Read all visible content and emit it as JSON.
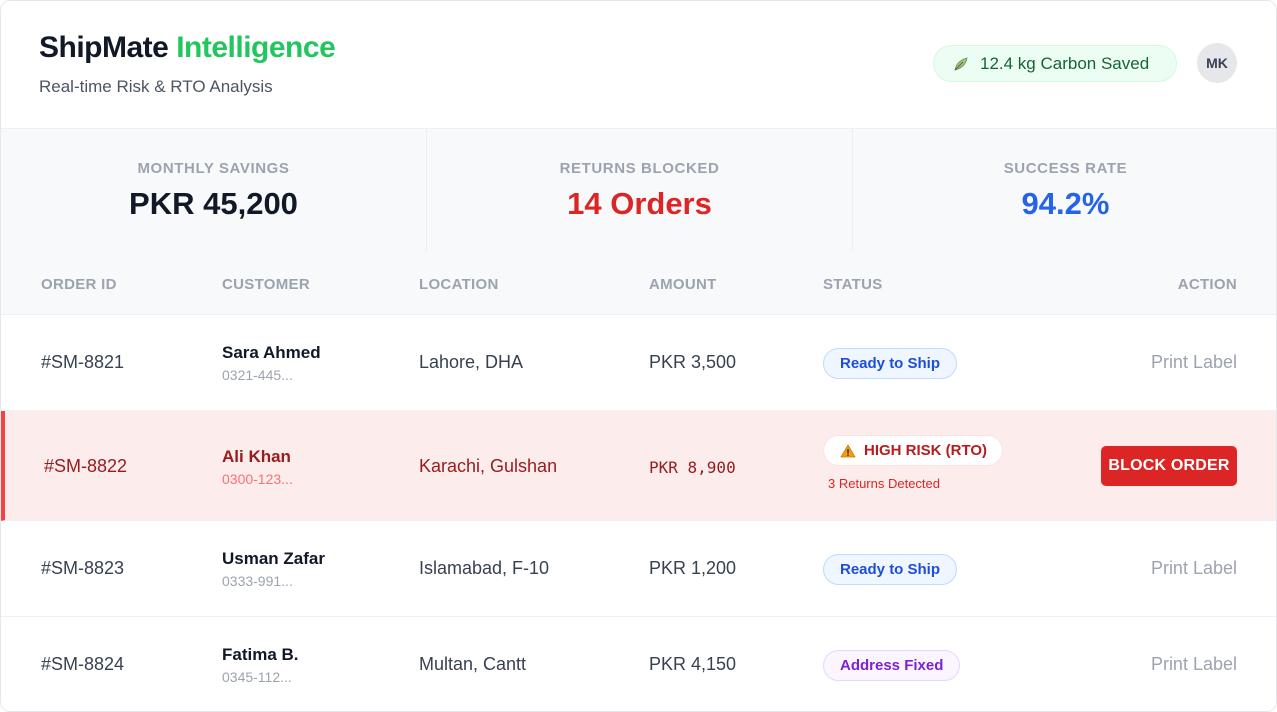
{
  "header": {
    "brand_main": "ShipMate",
    "brand_accent": "Intelligence",
    "subtitle": "Real-time Risk & RTO Analysis",
    "carbon_text": "12.4 kg Carbon Saved",
    "avatar_initials": "MK"
  },
  "stats": [
    {
      "label": "MONTHLY SAVINGS",
      "value": "PKR 45,200"
    },
    {
      "label": "RETURNS BLOCKED",
      "value": "14 Orders"
    },
    {
      "label": "SUCCESS RATE",
      "value": "94.2%"
    }
  ],
  "table": {
    "columns": [
      "ORDER ID",
      "CUSTOMER",
      "LOCATION",
      "AMOUNT",
      "STATUS",
      "ACTION"
    ],
    "rows": [
      {
        "order_id": "#SM-8821",
        "name": "Sara Ahmed",
        "phone": "0321-445...",
        "location": "Lahore, DHA",
        "amount": "PKR 3,500",
        "status": "Ready to Ship",
        "action": "Print Label"
      },
      {
        "order_id": "#SM-8822",
        "name": "Ali Khan",
        "phone": "0300-123...",
        "location": "Karachi, Gulshan",
        "amount": "PKR 8,900",
        "status": "HIGH RISK (RTO)",
        "note": "3 Returns Detected",
        "action": "BLOCK ORDER"
      },
      {
        "order_id": "#SM-8823",
        "name": "Usman Zafar",
        "phone": "0333-991...",
        "location": "Islamabad, F-10",
        "amount": "PKR 1,200",
        "status": "Ready to Ship",
        "action": "Print Label"
      },
      {
        "order_id": "#SM-8824",
        "name": "Fatima B.",
        "phone": "0345-112...",
        "location": "Multan, Cantt",
        "amount": "PKR 4,150",
        "status": "Address Fixed",
        "action": "Print Label"
      }
    ]
  },
  "colors": {
    "brand_accent": "#22c55e",
    "risk_red": "#dc2626",
    "success_blue": "#2563eb",
    "ready_badge": "#1d4ed8",
    "fixed_badge": "#7e22ce"
  },
  "icons": {
    "carbon": "leaf-icon",
    "risk": "warning-icon"
  }
}
